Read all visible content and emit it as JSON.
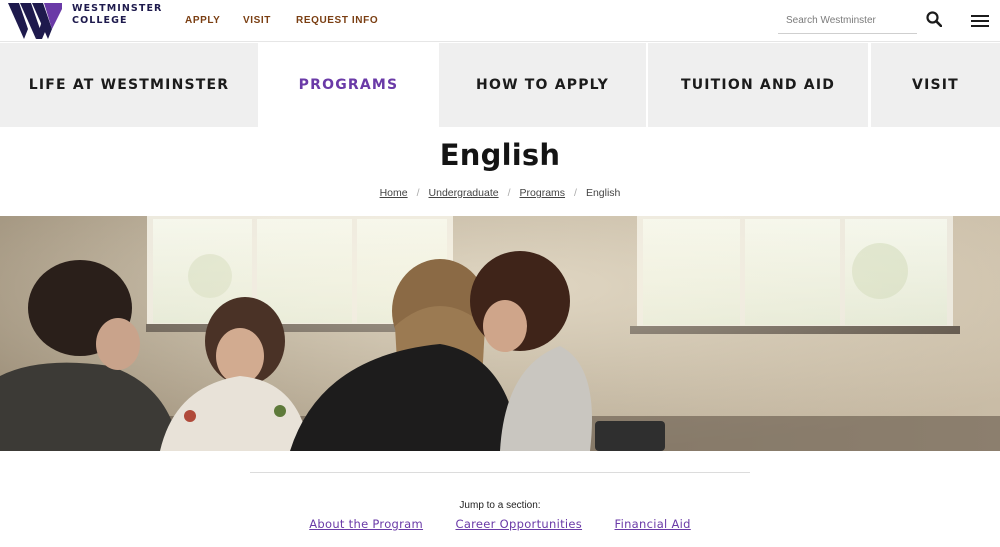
{
  "brand": {
    "line1": "WESTMINSTER",
    "line2": "COLLEGE",
    "accent": "#6a3aa7",
    "navy": "#1e1a4d",
    "utility_color": "#7a3e12"
  },
  "utility_nav": [
    {
      "label": "APPLY"
    },
    {
      "label": "VISIT"
    },
    {
      "label": "REQUEST INFO"
    }
  ],
  "search": {
    "placeholder": "Search Westminster",
    "icon": "search-icon"
  },
  "menu": {
    "icon": "hamburger-menu-icon"
  },
  "main_nav": [
    {
      "label": "LIFE AT WESTMINSTER",
      "active": false
    },
    {
      "label": "PROGRAMS",
      "active": true
    },
    {
      "label": "HOW TO APPLY",
      "active": false
    },
    {
      "label": "TUITION AND AID",
      "active": false
    },
    {
      "label": "VISIT",
      "active": false
    }
  ],
  "page": {
    "title": "English"
  },
  "breadcrumb": [
    {
      "label": "Home",
      "link": true
    },
    {
      "label": "Undergraduate",
      "link": true
    },
    {
      "label": "Programs",
      "link": true
    },
    {
      "label": "English",
      "link": false
    }
  ],
  "jump": {
    "label": "Jump to a section:",
    "links": [
      {
        "label": "About the Program"
      },
      {
        "label": "Career Opportunities"
      },
      {
        "label": "Financial Aid"
      }
    ]
  }
}
